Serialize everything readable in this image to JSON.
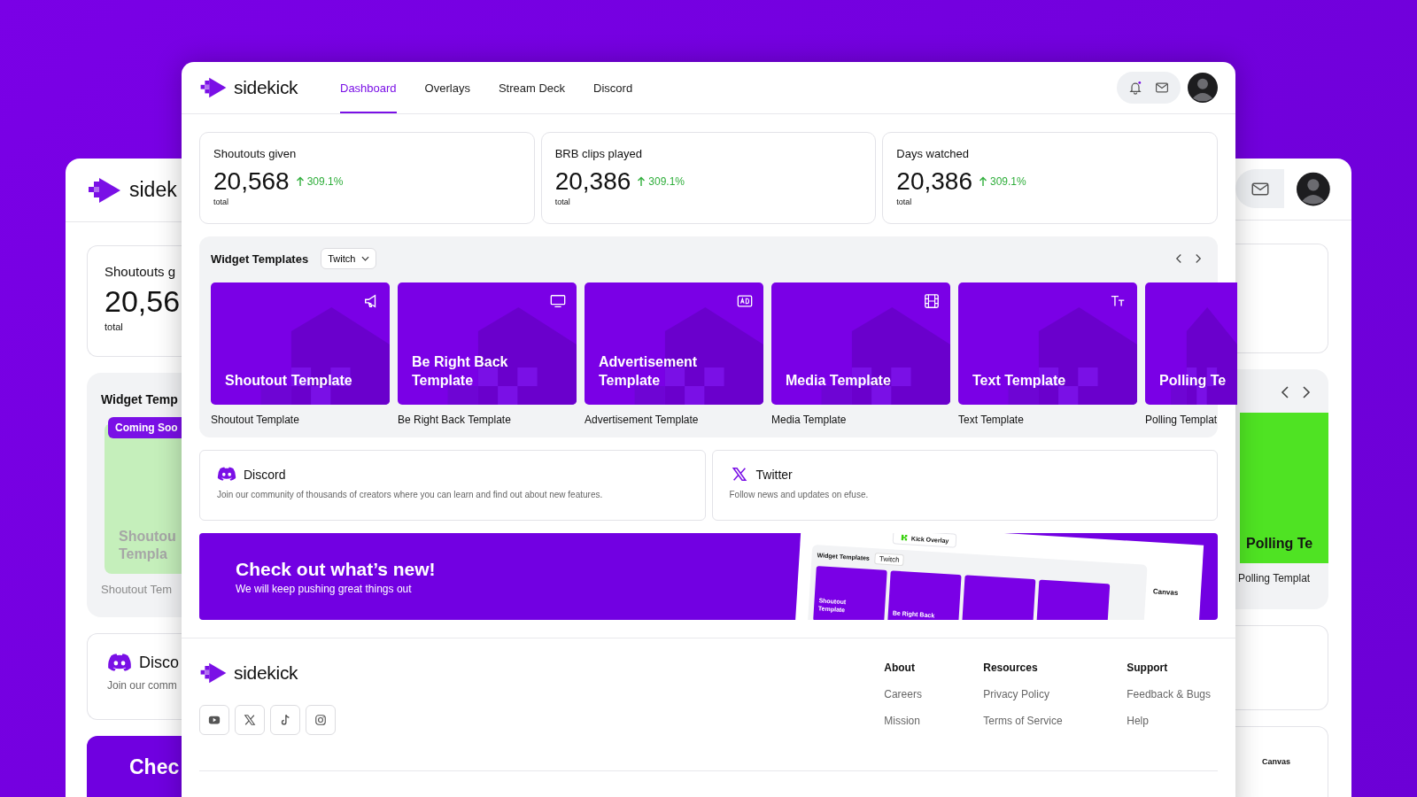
{
  "background_window": {
    "left": {
      "logo_text": "sidek",
      "stat_label": "Shoutouts g",
      "stat_value": "20,56",
      "stat_unit": "total",
      "section_title": "Widget Temp",
      "card": {
        "badge": "Coming Soo",
        "title_lines": [
          "Shoutou",
          "Templa"
        ],
        "label": "Shoutout Tem",
        "disabled": true
      },
      "discord_title": "Disco",
      "discord_text": "Join our comm",
      "banner_title": "Chec"
    },
    "right": {
      "card": {
        "title_lines": [
          "Polling Te"
        ],
        "label": "Polling Templat",
        "disabled": false
      },
      "preview_title": "Canvas"
    }
  },
  "window": {
    "brand": "sidekick",
    "tabs": [
      {
        "label": "Dashboard",
        "selected": true
      },
      {
        "label": "Overlays",
        "selected": false
      },
      {
        "label": "Stream Deck",
        "selected": false
      },
      {
        "label": "Discord",
        "selected": false
      }
    ]
  },
  "stats": [
    {
      "label": "Shoutouts given",
      "value": "20,568",
      "change": "309.1%",
      "unit": "total"
    },
    {
      "label": "BRB clips played",
      "value": "20,386",
      "change": "309.1%",
      "unit": "total"
    },
    {
      "label": "Days watched",
      "value": "20,386",
      "change": "309.1%",
      "unit": "total"
    }
  ],
  "widget_templates": {
    "title": "Widget Templates",
    "platform": "Twitch",
    "cards": [
      {
        "kind": "shoutout",
        "title": "Shoutout Template",
        "label": "Shoutout Template"
      },
      {
        "kind": "brb",
        "title": "Be Right Back Template",
        "label": "Be Right Back Template"
      },
      {
        "kind": "ad",
        "title": "Advertisement Template",
        "label": "Advertisement Template"
      },
      {
        "kind": "media",
        "title": "Media Template",
        "label": "Media Template"
      },
      {
        "kind": "text",
        "title": "Text Template",
        "label": "Text Template"
      },
      {
        "kind": "partial",
        "title": "Polling Te",
        "label": "Polling Templat"
      }
    ]
  },
  "social_cards": [
    {
      "kind": "discord",
      "title": "Discord",
      "text": "Join our community of thousands of creators where you can learn and find out about new features."
    },
    {
      "kind": "twitter",
      "title": "Twitter",
      "text": "Follow news and updates on efuse."
    }
  ],
  "banner": {
    "title": "Check out what’s new!",
    "subtitle": "We will keep pushing great things out",
    "preview": {
      "tab": "Kick Overlay",
      "section_title": "Widget Templates",
      "platform": "Twitch",
      "cards": [
        "Shoutout Template",
        "Be Right Back"
      ],
      "side_title": "Canvas"
    }
  },
  "footer": {
    "brand": "sidekick",
    "social": [
      {
        "kind": "youtube"
      },
      {
        "kind": "x"
      },
      {
        "kind": "tiktok"
      },
      {
        "kind": "instagram"
      }
    ],
    "columns": [
      {
        "title": "About",
        "links": [
          "Careers",
          "Mission"
        ]
      },
      {
        "title": "Resources",
        "links": [
          "Privacy Policy",
          "Terms of Service"
        ]
      },
      {
        "title": "Support",
        "links": [
          "Feedback & Bugs",
          "Help"
        ]
      }
    ]
  }
}
